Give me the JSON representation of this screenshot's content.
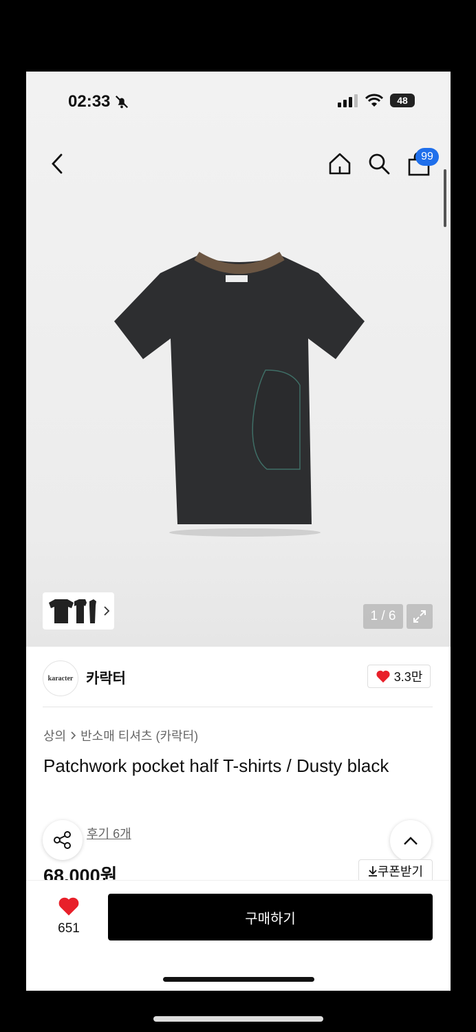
{
  "status_bar": {
    "time": "02:33",
    "battery": "48"
  },
  "header": {
    "cart_badge": "99"
  },
  "gallery": {
    "counter": "1 / 6"
  },
  "brand": {
    "logo_text": "karacter",
    "name": "카락터",
    "likes": "3.3만"
  },
  "breadcrumb": {
    "category": "상의",
    "subcategory": "반소매 티셔츠 (카락터)"
  },
  "product": {
    "title": "Patchwork pocket half T-shirts / Dusty black",
    "review_link": "후기 6개",
    "price": "68,000원",
    "coupon_label": "쿠폰받기"
  },
  "bottom_bar": {
    "like_count": "651",
    "buy_label": "구매하기"
  },
  "colors": {
    "accent": "#1f6feb",
    "heart": "#e8202a",
    "buy_button": "#000000"
  }
}
